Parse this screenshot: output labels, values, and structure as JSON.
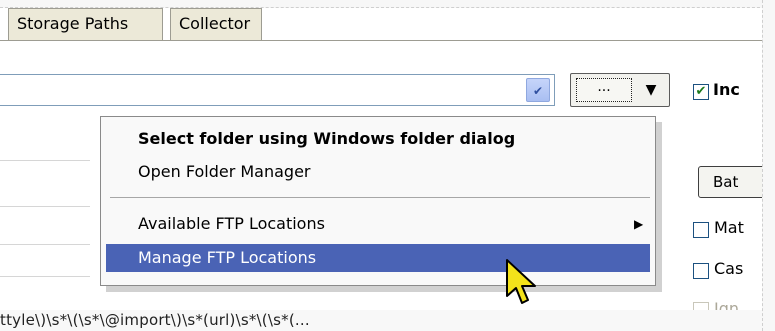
{
  "tabs": [
    {
      "label": "Storage Paths"
    },
    {
      "label": "Collector"
    }
  ],
  "toolbar": {
    "browse_label": "...",
    "include_checkbox_label": "Inc",
    "include_checked": true
  },
  "menu": {
    "items": [
      {
        "label": "Select folder using Windows folder dialog",
        "bold": true
      },
      {
        "label": "Open Folder Manager"
      },
      {
        "label": "Available FTP Locations",
        "has_submenu": true
      },
      {
        "label": "Manage FTP Locations",
        "selected": true
      }
    ]
  },
  "right_panel": {
    "button_label": "Bat",
    "checks": [
      {
        "label": "Mat",
        "checked": false,
        "enabled": true
      },
      {
        "label": "Cas",
        "checked": false,
        "enabled": true
      },
      {
        "label": "Ign",
        "checked": false,
        "enabled": false
      }
    ]
  },
  "bottom_text": "ttyle\\)\\s*\\(\\s*\\@import\\)\\s*(url)\\s*\\(\\s*(...",
  "colors": {
    "selection": "#4a63b5",
    "check_green": "#1c7a1c",
    "tab_bg": "#ece9d8"
  }
}
